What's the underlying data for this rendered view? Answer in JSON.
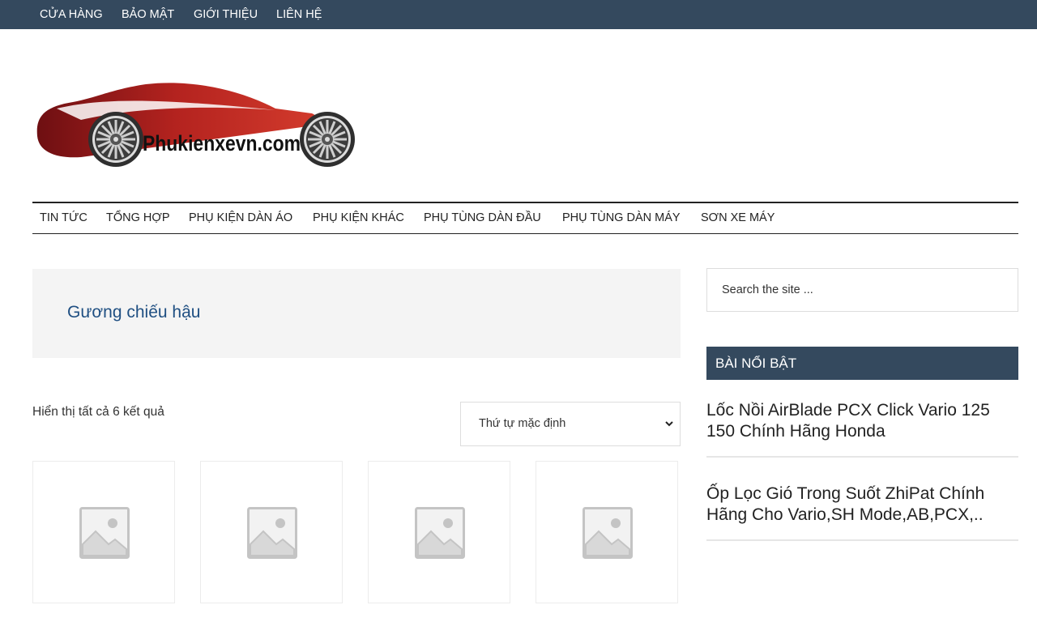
{
  "top_nav": [
    "CỬA HÀNG",
    "BẢO MẬT",
    "GIỚI THIỆU",
    "LIÊN HỆ"
  ],
  "logo": {
    "text": "Phukienxevn.com",
    "colors": {
      "body": "#a8201f",
      "highlight": "#e04a3a",
      "wheel": "#3a3a3a",
      "text": "#111111"
    }
  },
  "main_nav": [
    "TIN TỨC",
    "TỔNG HỢP",
    "PHỤ KIỆN DÀN ÁO",
    "PHỤ KIỆN KHÁC",
    "PHỤ TÙNG DÀN ĐẦU",
    "PHỤ TÙNG DÀN MÁY",
    "SƠN XE MÁY"
  ],
  "category": {
    "title": "Gương chiếu hậu"
  },
  "results": {
    "count_text": "Hiển thị tất cả 6 kết quả"
  },
  "sort": {
    "selected": "Thứ tự mặc định"
  },
  "products": [
    {
      "icon": "image-placeholder-icon"
    },
    {
      "icon": "image-placeholder-icon"
    },
    {
      "icon": "image-placeholder-icon"
    },
    {
      "icon": "image-placeholder-icon"
    }
  ],
  "sidebar": {
    "search_placeholder": "Search the site ...",
    "widget_title": "BÀI NỔI BẬT",
    "posts": [
      {
        "title": "Lốc Nồi AirBlade PCX Click Vario 125 150 Chính Hãng Honda"
      },
      {
        "title": "Ốp Lọc Gió Trong Suốt ZhiPat Chính Hãng Cho Vario,SH Mode,AB,PCX,.."
      }
    ]
  },
  "colors": {
    "dark_bar": "#34495e",
    "category_title": "#1f4f82",
    "category_bg": "#f4f4f4"
  }
}
